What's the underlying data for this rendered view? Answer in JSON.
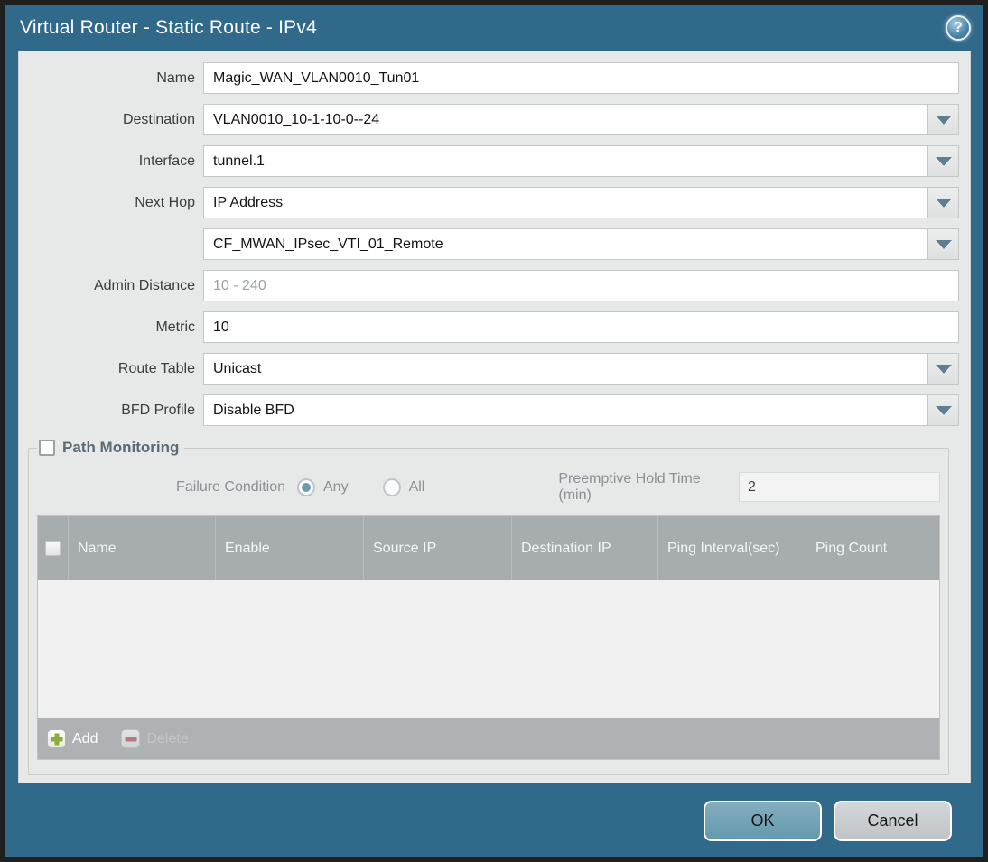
{
  "dialog": {
    "title": "Virtual Router - Static Route - IPv4",
    "help_glyph": "?"
  },
  "form": {
    "name": {
      "label": "Name",
      "value": "Magic_WAN_VLAN0010_Tun01"
    },
    "destination": {
      "label": "Destination",
      "value": "VLAN0010_10-1-10-0--24"
    },
    "interface": {
      "label": "Interface",
      "value": "tunnel.1"
    },
    "next_hop": {
      "label": "Next Hop",
      "value": "IP Address"
    },
    "next_hop_address": {
      "value": "CF_MWAN_IPsec_VTI_01_Remote"
    },
    "admin_distance": {
      "label": "Admin Distance",
      "placeholder": "10 - 240"
    },
    "metric": {
      "label": "Metric",
      "value": "10"
    },
    "route_table": {
      "label": "Route Table",
      "value": "Unicast"
    },
    "bfd_profile": {
      "label": "BFD Profile",
      "value": "Disable BFD"
    }
  },
  "path_monitoring": {
    "legend": "Path Monitoring",
    "enabled": false,
    "failure_condition": {
      "label": "Failure Condition",
      "options": [
        {
          "label": "Any",
          "selected": true
        },
        {
          "label": "All",
          "selected": false
        }
      ]
    },
    "preemptive_hold_time": {
      "label": "Preemptive Hold Time (min)",
      "value": "2"
    },
    "table": {
      "columns": [
        "Name",
        "Enable",
        "Source IP",
        "Destination IP",
        "Ping Interval(sec)",
        "Ping Count"
      ],
      "rows": []
    },
    "toolbar": {
      "add_label": "Add",
      "delete_label": "Delete"
    }
  },
  "footer": {
    "ok_label": "OK",
    "cancel_label": "Cancel"
  },
  "colors": {
    "title_bar": "#31698a",
    "panel_bg": "#e7e8e8",
    "table_header": "#a7acaf",
    "ok_button": "#6fa3b7",
    "radio_selected": "#6e9bb1",
    "add_plus": "#8caa3e",
    "delete_minus": "#a65c5c"
  }
}
